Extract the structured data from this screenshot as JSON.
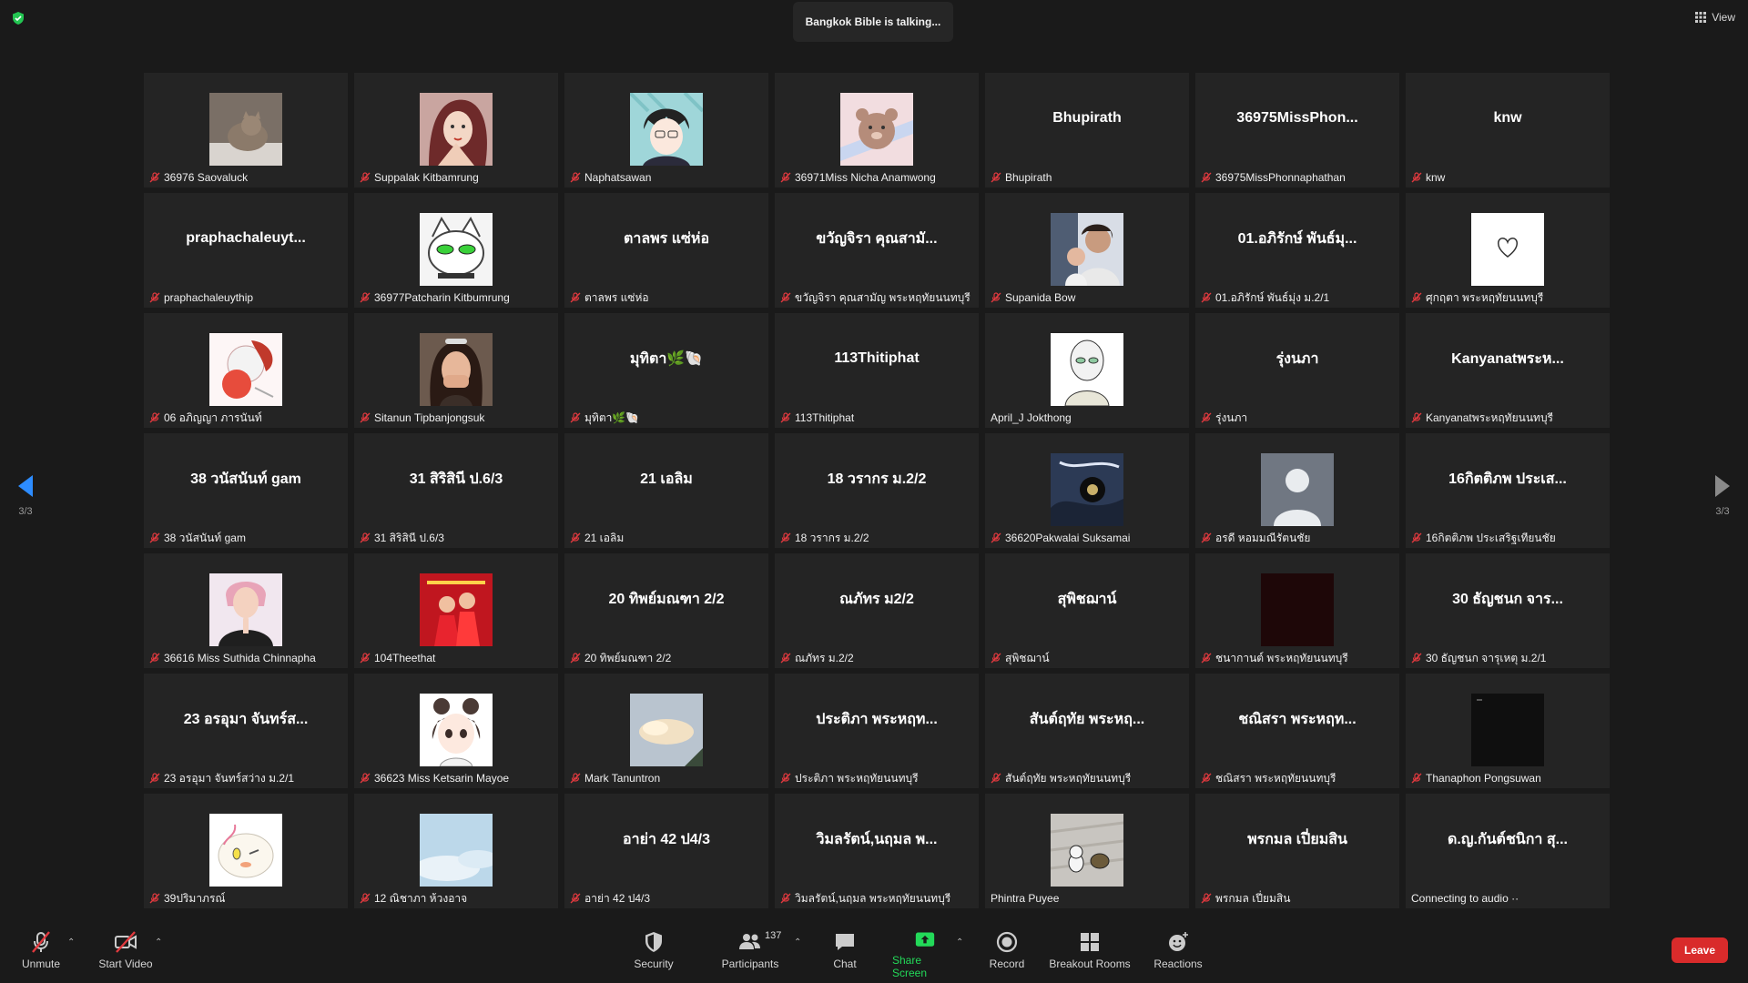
{
  "header": {
    "talking": "Bangkok Bible is talking...",
    "view_label": "View"
  },
  "pager": {
    "left": "3/3",
    "right": "3/3"
  },
  "tiles": [
    {
      "name": "36976 Saovaluck",
      "avatar": "cat-photo"
    },
    {
      "name": "Suppalak Kitbamrung",
      "avatar": "cartoon-princess"
    },
    {
      "name": "Naphatsawan",
      "avatar": "anime-boy"
    },
    {
      "name": "36971Miss Nicha Anamwong",
      "avatar": "teddy-bear"
    },
    {
      "center": "Bhupirath",
      "name": "Bhupirath"
    },
    {
      "center": "36975MissPhon...",
      "name": "36975MissPhonnaphathan"
    },
    {
      "center": "knw",
      "name": "knw"
    },
    {
      "center": "praphachaleuyt...",
      "name": "praphachaleuythip"
    },
    {
      "name": "36977Patcharin Kitbumrung",
      "avatar": "white-cat"
    },
    {
      "center": "ตาลพร แซ่ห่อ",
      "name": "ตาลพร แซ่ห่อ"
    },
    {
      "center": "ขวัญจิรา คุณสามั...",
      "name": "ขวัญจิรา คุณสามัญ พระหฤทัยนนทบุรี"
    },
    {
      "name": "Supanida Bow",
      "avatar": "mother-baby-photo"
    },
    {
      "center": "01.อภิรักษ์ พันธ์มุ...",
      "name": "01.อภิรักษ์ พันธ์มุ่ง ม.2/1"
    },
    {
      "name": "ศุกฤตา พระหฤทัยนนทบุรี",
      "avatar": "white-heart"
    },
    {
      "name": "06 อภิญญา ภารนันท์",
      "avatar": "cartoon-red"
    },
    {
      "name": "Sitanun Tipbanjongsuk",
      "avatar": "girl-photo"
    },
    {
      "center": "มุทิตา🌿🐚",
      "name": "มุทิตา🌿🐚"
    },
    {
      "center": "113Thitiphat",
      "name": "113Thitiphat"
    },
    {
      "name": "April_J Jokthong",
      "avatar": "alien-sketch",
      "muted": false
    },
    {
      "center": "รุ่งนภา",
      "name": "รุ่งนภา"
    },
    {
      "center": "Kanyanatพระห...",
      "name": "Kanyanatพระหฤทัยนนทบุรี"
    },
    {
      "center": "38 วนัสนันท์ gam",
      "name": "38 วนัสนันท์ gam"
    },
    {
      "center": "31 สิริสินี ป.6/3",
      "name": "31 สิริสินี ป.6/3"
    },
    {
      "center": "21 เอลิม",
      "name": "21 เอลิม"
    },
    {
      "center": "18 วรากร ม.2/2",
      "name": "18 วรากร ม.2/2"
    },
    {
      "name": "36620Pakwalai Suksamai",
      "avatar": "dark-art"
    },
    {
      "name": "อรดี หอมมณีรัตนชัย",
      "avatar": "default-person"
    },
    {
      "center": "16กิตติภพ ประเส...",
      "name": "16กิตติภพ ประเสริฐเทียนชัย"
    },
    {
      "name": "36616 Miss Suthida Chinnapha",
      "avatar": "praying-photo"
    },
    {
      "name": "104Theethat",
      "avatar": "red-poster"
    },
    {
      "center": "20 ทิพย์มณฑา 2/2",
      "name": "20 ทิพย์มณฑา 2/2"
    },
    {
      "center": "ณภัทร ม2/2",
      "name": "ณภัทร ม.2/2"
    },
    {
      "center": "สุพิชฌาน์",
      "name": "สุพิชฌาน์"
    },
    {
      "name": "ชนากานต์ พระหฤทัยนนทบุรี",
      "avatar": "dark-red"
    },
    {
      "center": "30 ธัญชนก    จาร...",
      "name": "30 ธัญชนก    จารุเหตุ ม.2/1"
    },
    {
      "center": "23 อรอุมา จันทร์ส...",
      "name": "23 อรอุมา จันทร์สว่าง ม.2/1"
    },
    {
      "name": "36623 Miss Ketsarin Mayoe",
      "avatar": "anime-girl"
    },
    {
      "name": "Mark Tanuntron",
      "avatar": "cloud-photo"
    },
    {
      "center": "ประติภา พระหฤท...",
      "name": "ประติภา พระหฤทัยนนทบุรี"
    },
    {
      "center": "สันต์ฤทัย พระหฤ...",
      "name": "สันต์ฤทัย พระหฤทัยนนทบุรี"
    },
    {
      "center": "ชณิสรา พระหฤท...",
      "name": "ชณิสรา พระหฤทัยนนทบุรี"
    },
    {
      "name": "Thanaphon Pongsuwan",
      "avatar": "black-video"
    },
    {
      "name": "39ปริมาภรณ์",
      "avatar": "chick-sticker"
    },
    {
      "name": "12 ณิชาภา ห้วงอาจ",
      "avatar": "sky-photo"
    },
    {
      "center": "อาย่า 42 ป4/3",
      "name": "อาย่า 42 ป4/3"
    },
    {
      "center": "วิมลรัตน์,นฤมล พ...",
      "name": "วิมลรัตน์,นฤมล พระหฤทัยนนทบุรี"
    },
    {
      "name": "Phintra Puyee",
      "avatar": "snoopy-photo",
      "muted": false
    },
    {
      "center": "พรกมล เปี่ยมสิน",
      "name": "พรกมล เปี่ยมสิน"
    },
    {
      "center": "ด.ญ.กันต์ชนิกา สุ...",
      "name": "Connecting to audio ··",
      "muted": false
    }
  ],
  "toolbar": {
    "unmute": "Unmute",
    "start_video": "Start Video",
    "security": "Security",
    "participants": "Participants",
    "participants_count": "137",
    "chat": "Chat",
    "share_screen": "Share Screen",
    "record": "Record",
    "breakout": "Breakout Rooms",
    "reactions": "Reactions",
    "leave": "Leave"
  },
  "colors": {
    "share_green": "#23d959",
    "leave_red": "#d92b2b",
    "mute_red": "#e0393e"
  }
}
